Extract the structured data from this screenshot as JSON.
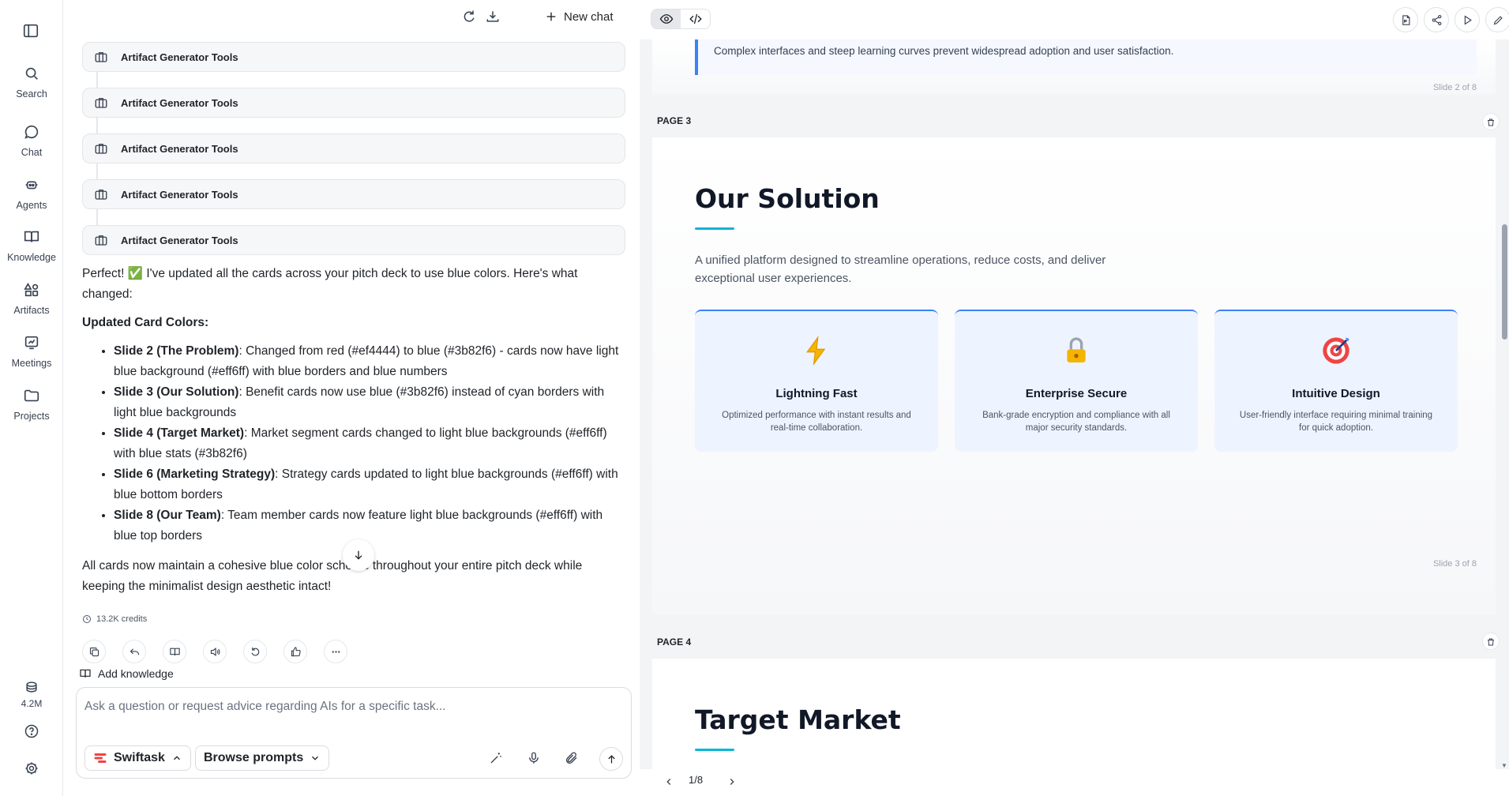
{
  "nav": {
    "items": [
      {
        "label": "Search",
        "icon": "search-icon"
      },
      {
        "label": "Chat",
        "icon": "chat-icon"
      },
      {
        "label": "Agents",
        "icon": "agents-icon"
      },
      {
        "label": "Knowledge",
        "icon": "book-icon"
      },
      {
        "label": "Artifacts",
        "icon": "artifacts-icon"
      },
      {
        "label": "Meetings",
        "icon": "meetings-icon"
      },
      {
        "label": "Projects",
        "icon": "folder-icon"
      }
    ],
    "balance": "4.2M"
  },
  "chat": {
    "new_chat": "New chat",
    "tool_cards": [
      "Artifact Generator Tools",
      "Artifact Generator Tools",
      "Artifact Generator Tools",
      "Artifact Generator Tools",
      "Artifact Generator Tools"
    ],
    "intro": "Perfect! ✅ I've updated all the cards across your pitch deck to use blue colors. Here's what changed:",
    "heading": "Updated Card Colors:",
    "changes": [
      {
        "bold": "Slide 2 (The Problem)",
        "text": ": Changed from red (#ef4444) to blue (#3b82f6) - cards now have light blue background (#eff6ff) with blue borders and blue numbers"
      },
      {
        "bold": "Slide 3 (Our Solution)",
        "text": ": Benefit cards now use blue (#3b82f6) instead of cyan borders with light blue backgrounds"
      },
      {
        "bold": "Slide 4 (Target Market)",
        "text": ": Market segment cards changed to light blue backgrounds (#eff6ff) with blue stats (#3b82f6)"
      },
      {
        "bold": "Slide 6 (Marketing Strategy)",
        "text": ": Strategy cards updated to light blue backgrounds (#eff6ff) with blue bottom borders"
      },
      {
        "bold": "Slide 8 (Our Team)",
        "text": ": Team member cards now feature light blue backgrounds (#eff6ff) with blue top borders"
      }
    ],
    "outro": "All cards now maintain a cohesive blue color scheme throughout your entire pitch deck while keeping the minimalist design aesthetic intact!",
    "credits": "13.2K credits",
    "add_knowledge": "Add knowledge",
    "input_placeholder": "Ask a question or request advice regarding AIs for a specific task...",
    "model": "Swiftask",
    "browse_prompts": "Browse prompts"
  },
  "preview": {
    "slide2_quote": "Complex interfaces and steep learning curves prevent widespread adoption and user satisfaction.",
    "slide2_footer": "Slide 2 of 8",
    "page3_label": "PAGE 3",
    "slide3": {
      "title": "Our Solution",
      "subtitle": "A unified platform designed to streamline operations, reduce costs, and deliver exceptional user experiences.",
      "cards": [
        {
          "icon": "lightning-icon",
          "title": "Lightning Fast",
          "desc": "Optimized performance with instant results and real-time collaboration."
        },
        {
          "icon": "lock-icon",
          "title": "Enterprise Secure",
          "desc": "Bank-grade encryption and compliance with all major security standards."
        },
        {
          "icon": "target-icon",
          "title": "Intuitive Design",
          "desc": "User-friendly interface requiring minimal training for quick adoption."
        }
      ],
      "footer": "Slide 3 of 8"
    },
    "page4_label": "PAGE 4",
    "slide4_title": "Target Market",
    "pager": "1/8"
  },
  "colors": {
    "accent_blue": "#3b82f6",
    "accent_cyan": "#06b6d4",
    "card_bg": "#eef4ff"
  }
}
